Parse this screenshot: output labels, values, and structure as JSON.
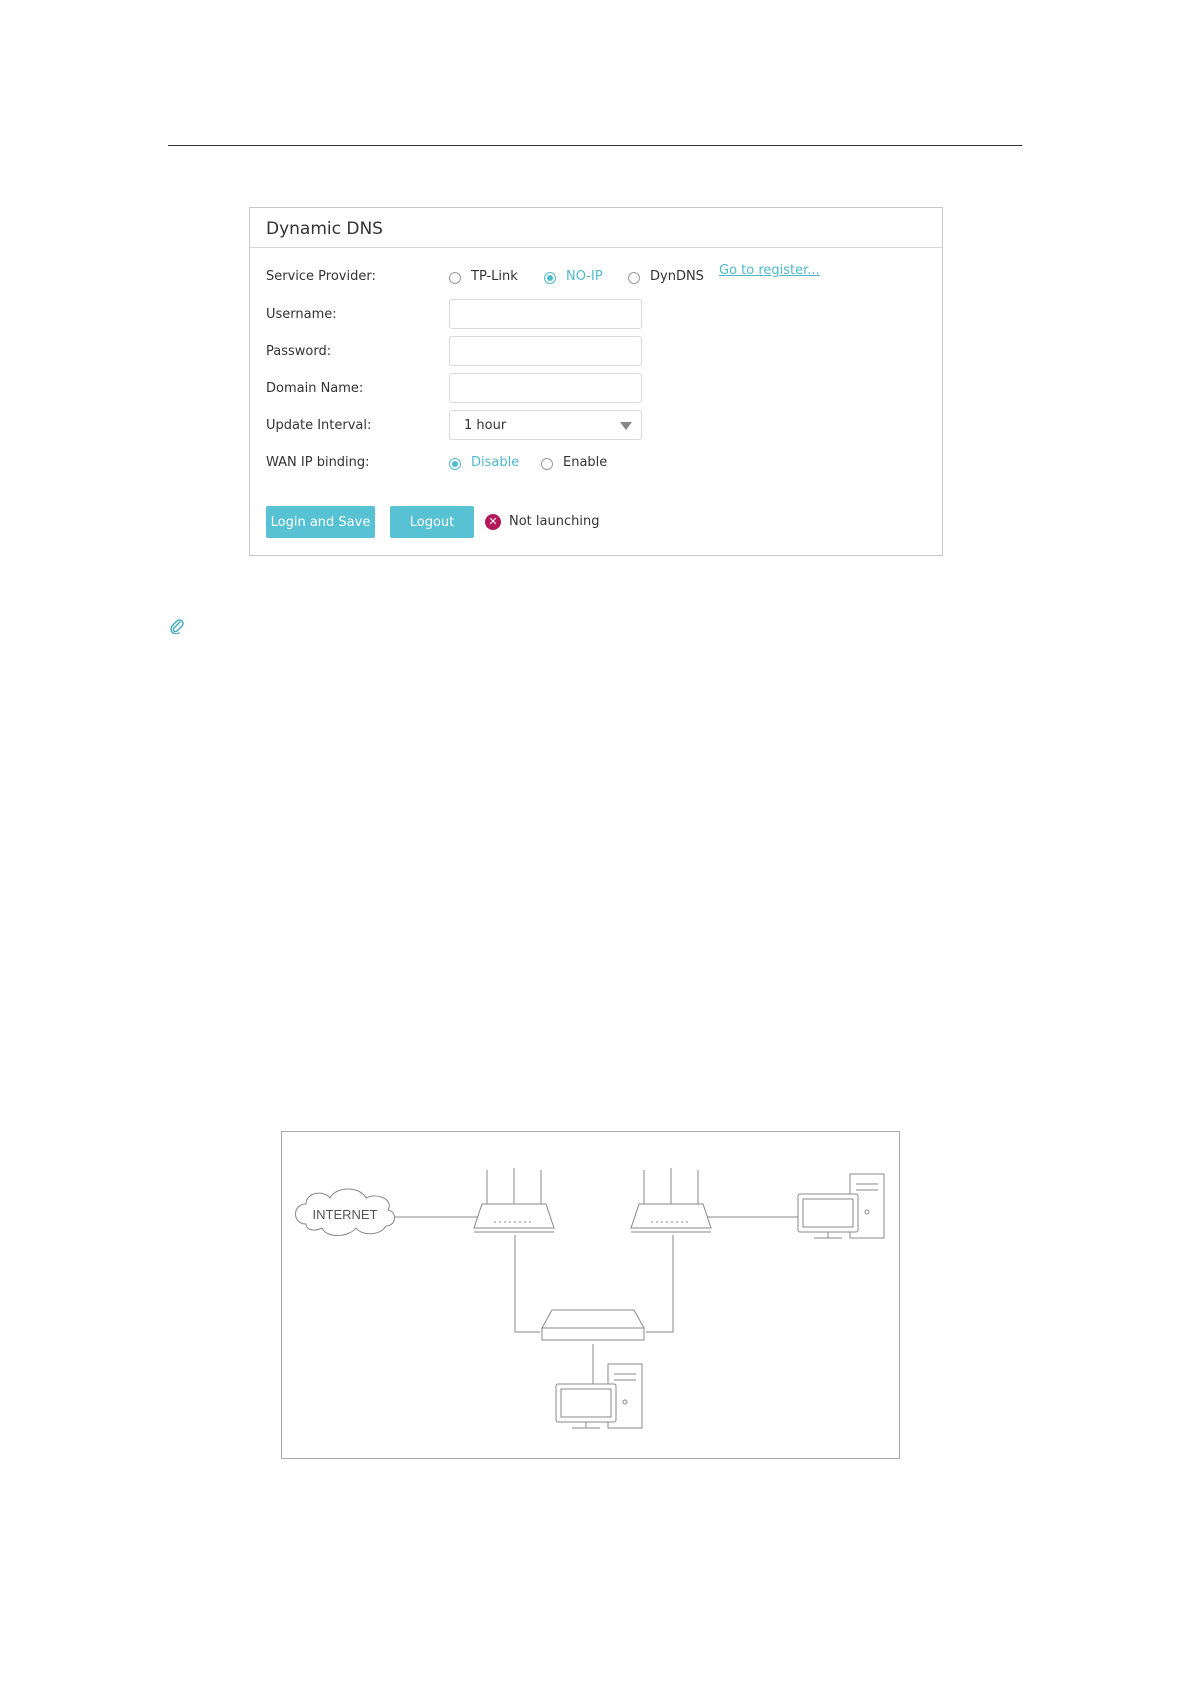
{
  "panel": {
    "title": "Dynamic DNS"
  },
  "form": {
    "service_provider": {
      "label": "Service Provider:",
      "options": [
        "TP-Link",
        "NO-IP",
        "DynDNS"
      ],
      "selected": "NO-IP",
      "register_link": "Go to register..."
    },
    "username": {
      "label": "Username:",
      "value": ""
    },
    "password": {
      "label": "Password:",
      "value": ""
    },
    "domain_name": {
      "label": "Domain Name:",
      "value": ""
    },
    "update_interval": {
      "label": "Update Interval:",
      "value": "1 hour"
    },
    "wan_ip_binding": {
      "label": "WAN IP binding:",
      "options": [
        "Disable",
        "Enable"
      ],
      "selected": "Disable"
    }
  },
  "actions": {
    "login_save_label": "Login and Save",
    "logout_label": "Logout"
  },
  "status": {
    "text": "Not launching",
    "icon": "error-x-icon"
  },
  "diagram": {
    "internet_label": "INTERNET"
  },
  "colors": {
    "accent": "#4fb9cc",
    "button": "#57c2d3",
    "error": "#b5175a"
  }
}
